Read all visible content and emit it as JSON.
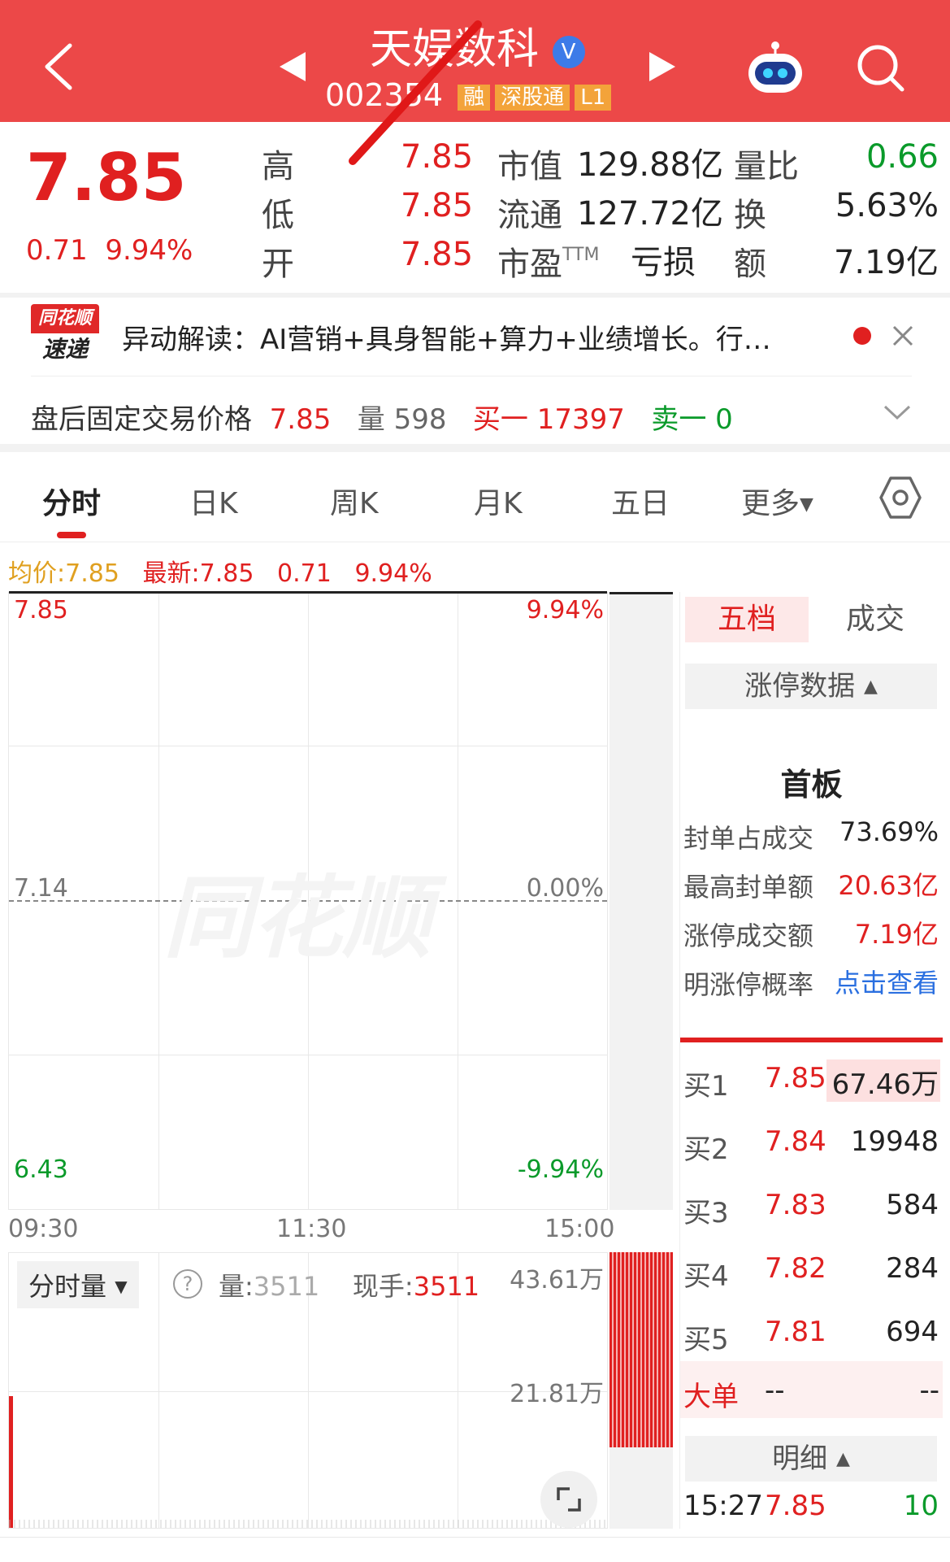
{
  "header": {
    "stock_name": "天娱数科",
    "stock_code": "002354",
    "tags": [
      "融",
      "深股通",
      "L1"
    ],
    "verified_badge": "V"
  },
  "quote": {
    "price": "7.85",
    "change": "0.71",
    "change_pct": "9.94%",
    "rows": [
      {
        "label1": "高",
        "val1": "7.85",
        "label2": "市值",
        "val2": "129.88亿",
        "label3": "量比",
        "val3": "0.66"
      },
      {
        "label1": "低",
        "val1": "7.85",
        "label2": "流通",
        "val2": "127.72亿",
        "label3": "换",
        "val3": "5.63%"
      },
      {
        "label1": "开",
        "val1": "7.85",
        "label2": "市盈",
        "label2_sup": "TTM",
        "val2": "亏损",
        "label3": "额",
        "val3": "7.19亿"
      }
    ]
  },
  "news": {
    "logo_top": "同花顺",
    "logo_bottom": "速递",
    "text": "异动解读：AI营销+具身智能+算力+业绩增长。行…"
  },
  "after_hours": {
    "label": "盘后固定交易价格",
    "price": "7.85",
    "vol_label": "量",
    "vol": "598",
    "buy_label": "买一",
    "buy": "17397",
    "sell_label": "卖一",
    "sell": "0"
  },
  "tabs": [
    "分时",
    "日K",
    "周K",
    "月K",
    "五日",
    "更多"
  ],
  "info_line": {
    "avg_label": "均价:",
    "avg": "7.85",
    "latest_label": "最新:",
    "latest": "7.85",
    "change": "0.71",
    "change_pct": "9.94%"
  },
  "chart": {
    "y_top": "7.85",
    "y_mid": "7.14",
    "y_bot": "6.43",
    "pct_top": "9.94%",
    "pct_mid": "0.00%",
    "pct_bot": "-9.94%",
    "x_labels": [
      "09:30",
      "11:30",
      "15:00"
    ],
    "watermark": "同花顺"
  },
  "volume": {
    "selector": "分时量",
    "vol_label": "量:",
    "vol": "3511",
    "hand_label": "现手:",
    "hand": "3511",
    "max": "43.61万",
    "mid": "21.81万"
  },
  "side": {
    "tab_five": "五档",
    "tab_trade": "成交",
    "limit_header": "涨停数据",
    "board": "首板",
    "stats": [
      {
        "label": "封单占成交",
        "value": "73.69%"
      },
      {
        "label": "最高封单额",
        "value": "20.63亿"
      },
      {
        "label": "涨停成交额",
        "value": "7.19亿"
      },
      {
        "label": "明涨停概率",
        "value": "点击查看"
      }
    ],
    "bids": [
      {
        "label": "买1",
        "price": "7.85",
        "vol": "67.46万"
      },
      {
        "label": "买2",
        "price": "7.84",
        "vol": "19948"
      },
      {
        "label": "买3",
        "price": "7.83",
        "vol": "584"
      },
      {
        "label": "买4",
        "price": "7.82",
        "vol": "284"
      },
      {
        "label": "买5",
        "price": "7.81",
        "vol": "694"
      }
    ],
    "big_label": "大单",
    "big_a": "--",
    "big_b": "--",
    "detail_label": "明细",
    "detail_time": "15:27",
    "detail_price": "7.85",
    "detail_vol": "10"
  },
  "colors": {
    "up": "#e02020",
    "down": "#0a9a2a",
    "header": "#ec4848"
  }
}
